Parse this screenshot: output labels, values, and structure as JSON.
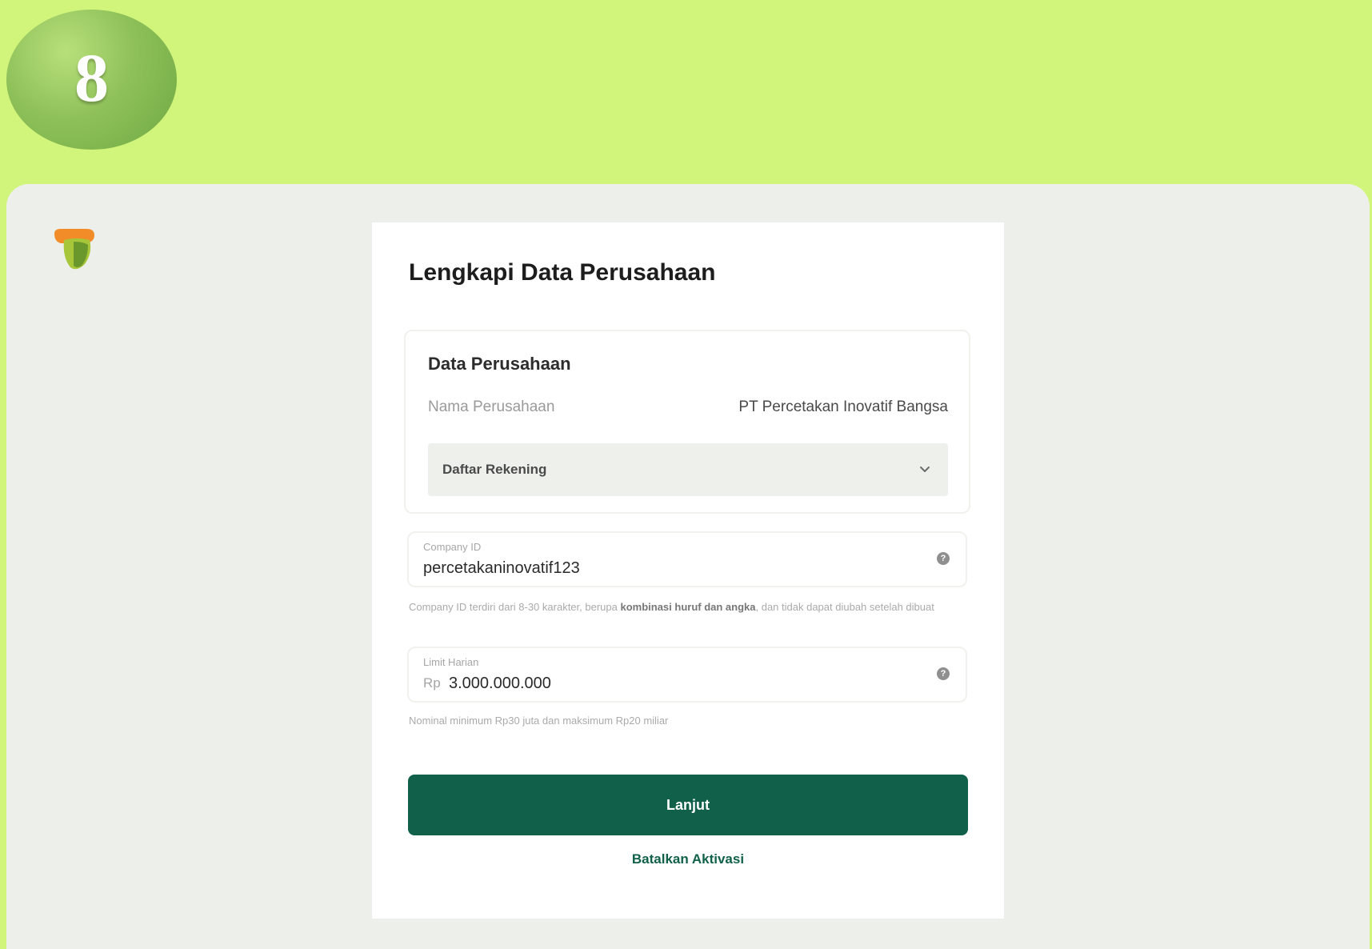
{
  "step": {
    "number": "8"
  },
  "form": {
    "title": "Lengkapi Data Perusahaan",
    "company": {
      "section_title": "Data Perusahaan",
      "name_label": "Nama Perusahaan",
      "name_value": "PT Percetakan Inovatif Bangsa",
      "accounts_label": "Daftar Rekening"
    },
    "company_id": {
      "label": "Company ID",
      "value": "percetakaninovatif123",
      "hint_before": "Company ID terdiri dari 8-30 karakter, berupa ",
      "hint_bold": "kombinasi huruf dan angka",
      "hint_after": ", dan tidak dapat diubah setelah dibuat"
    },
    "daily_limit": {
      "label": "Limit Harian",
      "currency": "Rp",
      "value": "3.000.000.000",
      "hint": "Nominal minimum Rp30 juta dan maksimum Rp20 miliar"
    },
    "primary_button": "Lanjut",
    "cancel_link": "Batalkan Aktivasi"
  },
  "colors": {
    "outer_background": "#d1f57a",
    "panel_background": "#edf0ea",
    "primary": "#11614a"
  },
  "icons": [
    "app-logo-icon",
    "chevron-down-icon",
    "help-icon"
  ]
}
